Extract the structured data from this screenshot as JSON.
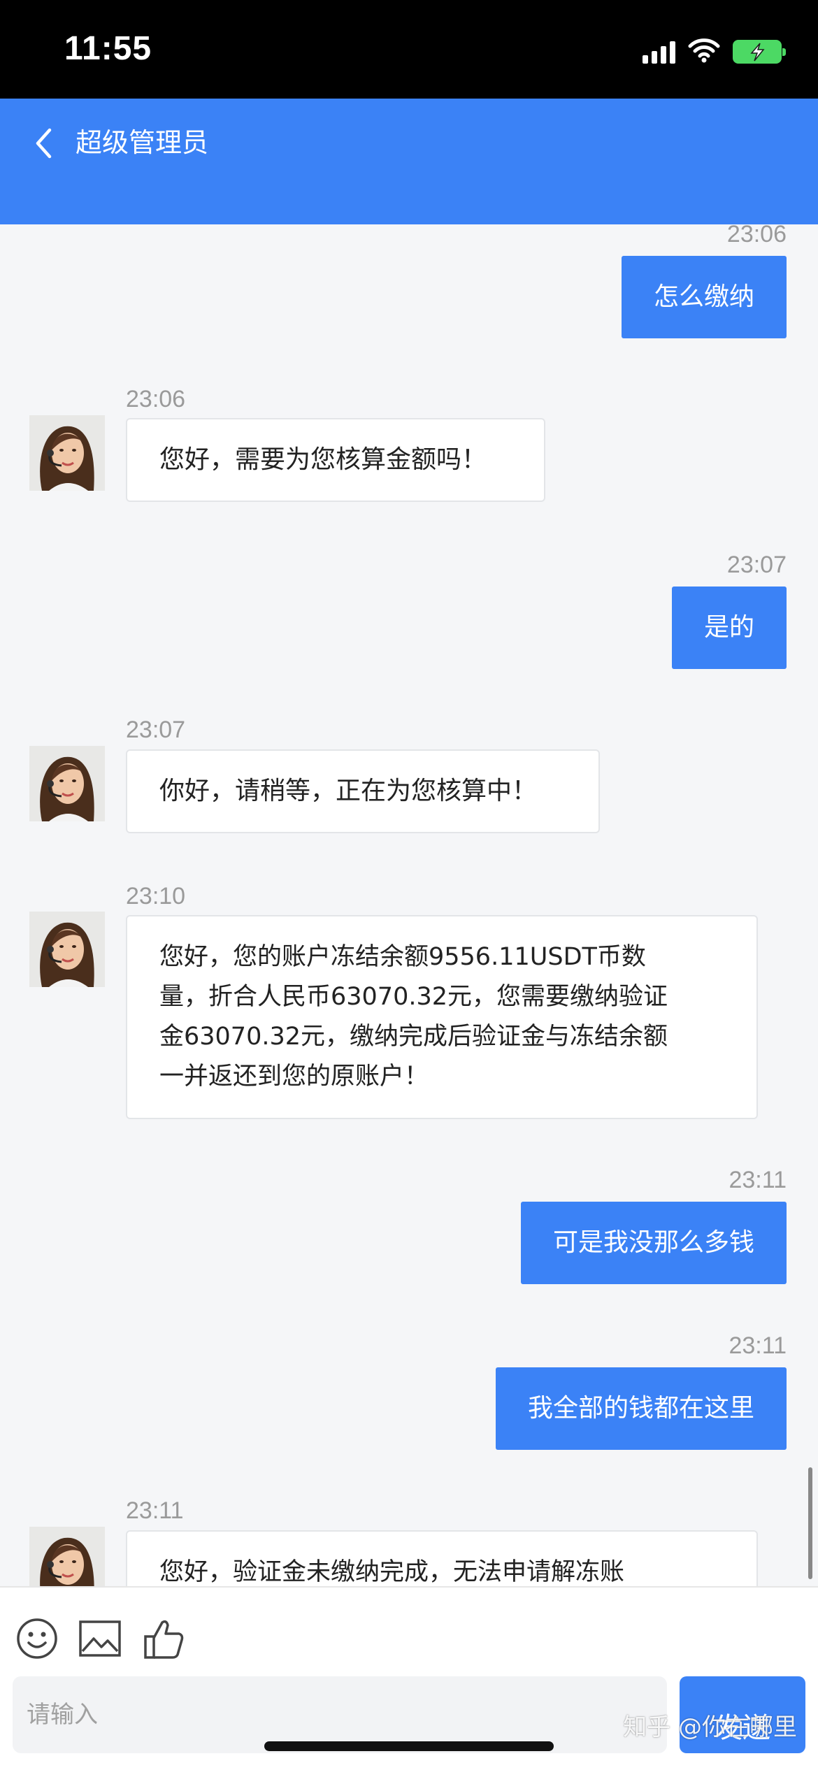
{
  "status_bar": {
    "time": "11:55"
  },
  "header": {
    "title": "超级管理员"
  },
  "messages": [
    {
      "time": "23:06",
      "text": "怎么缴纳"
    },
    {
      "time": "23:06",
      "text": "您好，需要为您核算金额吗！"
    },
    {
      "time": "23:07",
      "text": "是的"
    },
    {
      "time": "23:07",
      "text": "你好，请稍等，正在为您核算中！"
    },
    {
      "time": "23:10",
      "lines": [
        "您好，您的账户冻结余额9556.11USDT币数",
        "量，折合人民币63070.32元，您需要缴纳验证",
        "金63070.32元，缴纳完成后验证金与冻结余额",
        "一并返还到您的原账户！"
      ]
    },
    {
      "time": "23:11",
      "text": "可是我没那么多钱"
    },
    {
      "time": "23:11",
      "text": "我全部的钱都在这里"
    },
    {
      "time": "23:11",
      "text": "您好，验证金未缴纳完成，无法申请解冻账"
    }
  ],
  "input": {
    "placeholder": "请输入"
  },
  "send_label": "发送",
  "watermark": "知乎 @你在哪里",
  "icons": [
    "back-icon",
    "emoji-icon",
    "image-icon",
    "thumbs-up-icon",
    "signal-icon",
    "wifi-icon",
    "battery-icon"
  ],
  "colors": {
    "accent": "#3b82f6",
    "status_bar": "#000000",
    "battery": "#4cd964"
  }
}
